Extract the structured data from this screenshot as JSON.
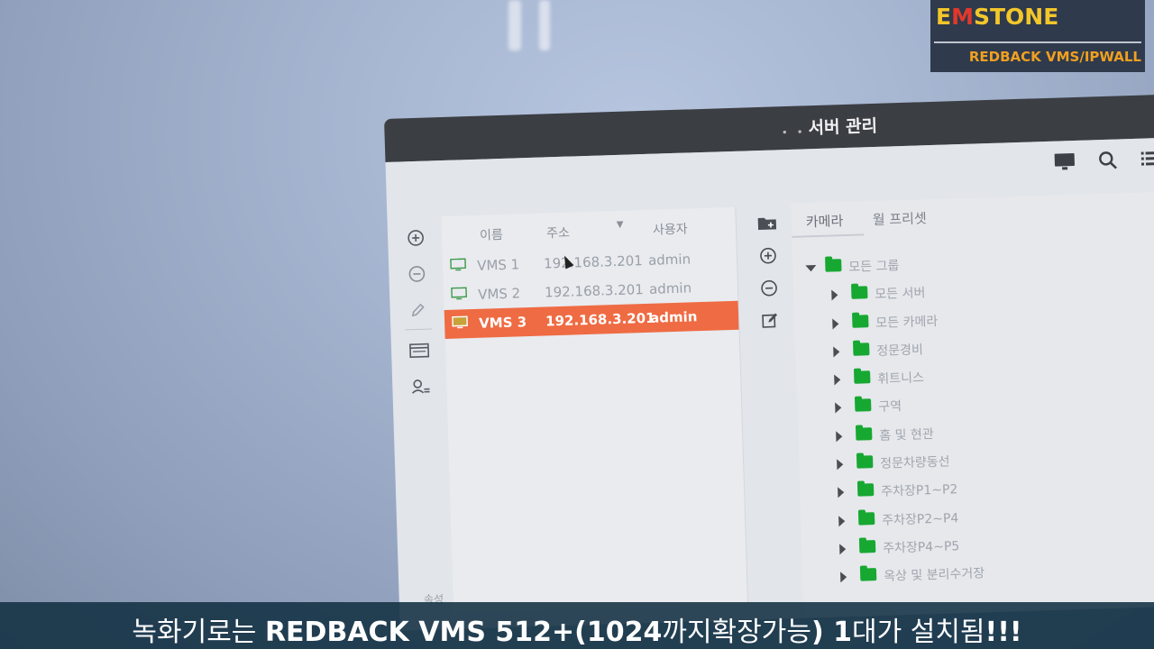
{
  "logo": {
    "brand_prefix": "E",
    "brand_m": "M",
    "brand_rest": "STONE",
    "subtitle": "REDBACK VMS/IPWALL"
  },
  "window": {
    "title": "서버 관리",
    "toolbar_icons": [
      "monitor-icon",
      "search-icon",
      "list-icon"
    ],
    "left_icons": [
      "add-circle-icon",
      "remove-circle-icon",
      "pencil-icon",
      "window-icon",
      "user-settings-icon"
    ],
    "middle_icons": [
      "folder-add-icon",
      "add-circle-icon",
      "remove-circle-icon",
      "edit-icon"
    ]
  },
  "server_list": {
    "columns": {
      "name": "이름",
      "address": "주소",
      "user": "사용자"
    },
    "rows": [
      {
        "name": "VMS 1",
        "address": "192.168.3.201",
        "user": "admin",
        "selected": false
      },
      {
        "name": "VMS 2",
        "address": "192.168.3.201",
        "user": "admin",
        "selected": false
      },
      {
        "name": "VMS 3",
        "address": "192.168.3.201",
        "user": "admin",
        "selected": true
      }
    ]
  },
  "right_panel": {
    "tabs": [
      "카메라",
      "월 프리셋"
    ],
    "tree": [
      {
        "label": "모든 그룹",
        "expanded": true,
        "level": 0
      },
      {
        "label": "모든 서버",
        "expanded": false,
        "level": 1
      },
      {
        "label": "모든 카메라",
        "expanded": false,
        "level": 1
      },
      {
        "label": "정문경비",
        "expanded": false,
        "level": 1
      },
      {
        "label": "휘트니스",
        "expanded": false,
        "level": 1
      },
      {
        "label": "구역",
        "expanded": false,
        "level": 1
      },
      {
        "label": "홈 및 현관",
        "expanded": false,
        "level": 1
      },
      {
        "label": "정문차량동선",
        "expanded": false,
        "level": 1
      },
      {
        "label": "주차장P1~P2",
        "expanded": false,
        "level": 1
      },
      {
        "label": "주차장P2~P4",
        "expanded": false,
        "level": 1
      },
      {
        "label": "주차장P4~P5",
        "expanded": false,
        "level": 1
      },
      {
        "label": "옥상 및 분리수거장",
        "expanded": false,
        "level": 1
      }
    ]
  },
  "bottom_label": "속성",
  "caption": {
    "prefix": "녹화기로는 ",
    "bold1": "REDBACK VMS 512+(1024",
    "mid1": "까지확장가능",
    "bold2": ") 1",
    "mid2": "대가 설치됨",
    "bold3": "!!!"
  },
  "colors": {
    "selected_row": "#ef6b43",
    "folder": "#17a832",
    "caption_bg": "#123042",
    "logo_yellow": "#f3c62a",
    "logo_red": "#e0392b"
  }
}
